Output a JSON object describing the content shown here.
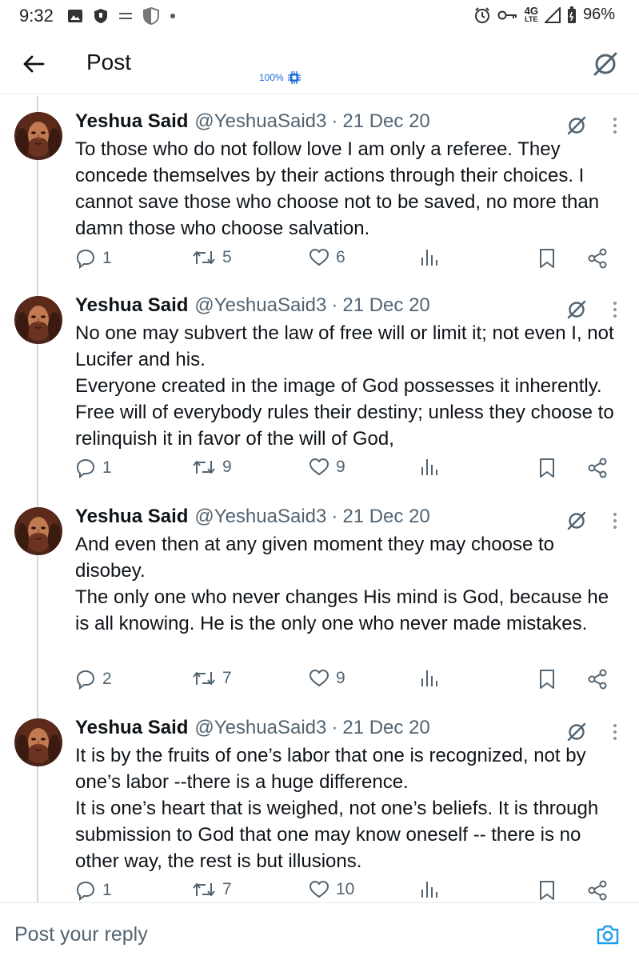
{
  "status_bar": {
    "time": "9:32",
    "network": "4G",
    "network_sub": "LTE",
    "battery": "96%",
    "left_icons": [
      "gallery-icon",
      "shield-icon",
      "equals-icon",
      "shield-icon",
      "dot-icon"
    ],
    "right_icons": [
      "alarm-icon",
      "key-icon",
      "signal-icon",
      "battery-icon"
    ]
  },
  "header": {
    "title": "Post",
    "cpu_label": "100%"
  },
  "colors": {
    "text": "#0f1419",
    "secondary": "#536471",
    "accent": "#1d9bf0",
    "divider": "#cfd9de"
  },
  "posts": [
    {
      "name": "Yeshua Said",
      "handle": "@YeshuaSaid3",
      "date": "21 Dec 20",
      "text": "To those who do not follow love I am only a referee.  They concede themselves by their actions through their choices.  I cannot save those who choose not to be saved, no more than damn those who choose salvation.",
      "replies": "1",
      "reposts": "5",
      "likes": "6"
    },
    {
      "name": "Yeshua Said",
      "handle": "@YeshuaSaid3",
      "date": "21 Dec 20",
      "text": "No one may subvert the law of free will or limit it; not even I, not Lucifer and his.\nEveryone created in the image of God possesses it inherently.  Free will of everybody rules their destiny; unless they choose to relinquish it in favor of the will of God,",
      "replies": "1",
      "reposts": "9",
      "likes": "9"
    },
    {
      "name": "Yeshua Said",
      "handle": "@YeshuaSaid3",
      "date": "21 Dec 20",
      "text": "And even then at any given moment they may choose to disobey.\nThe only one who never changes His mind is God, because he is all knowing.  He is the only one who never made mistakes.",
      "replies": "2",
      "reposts": "7",
      "likes": "9"
    },
    {
      "name": "Yeshua Said",
      "handle": "@YeshuaSaid3",
      "date": "21 Dec 20",
      "text": "It is by the fruits of one’s labor that one is recognized, not by one’s labor --there is a huge difference.\nIt is one’s heart that is weighed, not one’s beliefs.  It is through submission to God that one may know oneself -- there is no other way, the rest is but illusions.",
      "replies": "1",
      "reposts": "7",
      "likes": "10"
    }
  ],
  "reply_bar": {
    "placeholder": "Post your reply"
  }
}
